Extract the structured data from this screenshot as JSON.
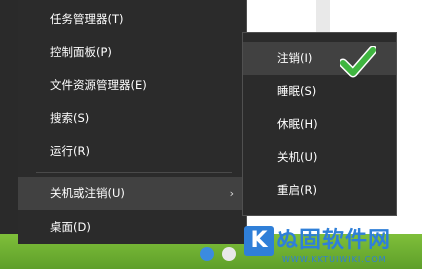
{
  "main_menu": {
    "items": [
      {
        "label": "任务管理器(T)"
      },
      {
        "label": "控制面板(P)"
      },
      {
        "label": "文件资源管理器(E)"
      },
      {
        "label": "搜索(S)"
      },
      {
        "label": "运行(R)"
      },
      {
        "label": "关机或注销(U)",
        "arrow": "›"
      },
      {
        "label": "桌面(D)"
      }
    ]
  },
  "submenu": {
    "items": [
      {
        "label": "注销(I)"
      },
      {
        "label": "睡眠(S)"
      },
      {
        "label": "休眠(H)"
      },
      {
        "label": "关机(U)"
      },
      {
        "label": "重启(R)"
      }
    ]
  },
  "checkmark": {
    "icon": "checkmark-icon",
    "color": "#3fb540"
  },
  "watermark": {
    "logo_letter": "K",
    "text": "ぬ固软件网",
    "url": "WWW.KKTUIWIKI.COM"
  },
  "colors": {
    "menu_bg": "#2b2b2b",
    "hover_bg": "#414141",
    "taskbar": "#6aad33",
    "watermark_blue": "#2f7fd8"
  }
}
